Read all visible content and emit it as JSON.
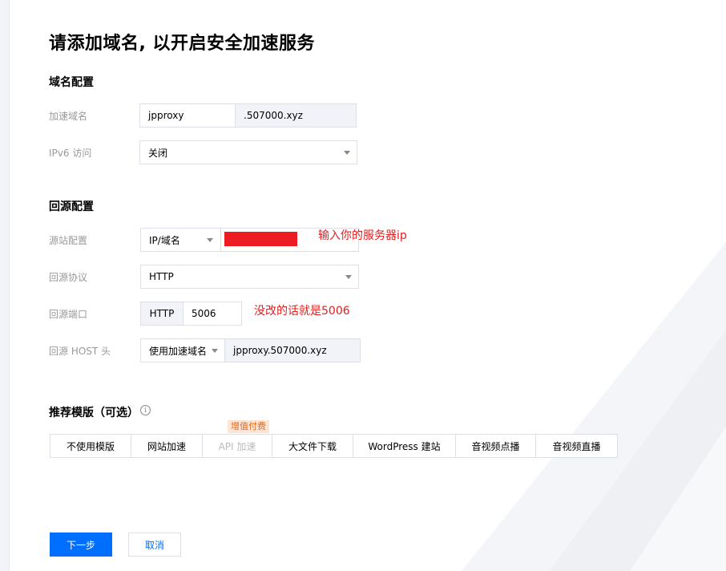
{
  "page": {
    "title": "请添加域名, 以开启安全加速服务"
  },
  "domain_config": {
    "section_title": "域名配置",
    "accel_domain_label": "加速域名",
    "subdomain_value": "jpproxy",
    "root_domain_value": ".507000.xyz",
    "ipv6_label": "IPv6 访问",
    "ipv6_value": "关闭"
  },
  "origin_config": {
    "section_title": "回源配置",
    "origin_label": "源站配置",
    "origin_type": "IP/域名",
    "origin_annotation": "输入你的服务器ip",
    "protocol_label": "回源协议",
    "protocol_value": "HTTP",
    "port_label": "回源端口",
    "port_prefix": "HTTP",
    "port_value": "5006",
    "port_annotation": "没改的话就是5006",
    "host_label": "回源 HOST 头",
    "host_mode": "使用加速域名",
    "host_value": "jpproxy.507000.xyz"
  },
  "templates": {
    "section_title": "推荐模版（可选）",
    "info_icon_glyph": "i",
    "badge": "增值付费",
    "items": [
      "不使用模版",
      "网站加速",
      "API 加速",
      "大文件下载",
      "WordPress 建站",
      "音视频点播",
      "音视频直播"
    ]
  },
  "actions": {
    "next_label": "下一步",
    "cancel_label": "取消"
  },
  "colors": {
    "primary": "#006eff",
    "annotation": "#e02020",
    "redaction": "#ed1c24",
    "badge_bg": "#fde5d6",
    "badge_text": "#e56a1c"
  }
}
